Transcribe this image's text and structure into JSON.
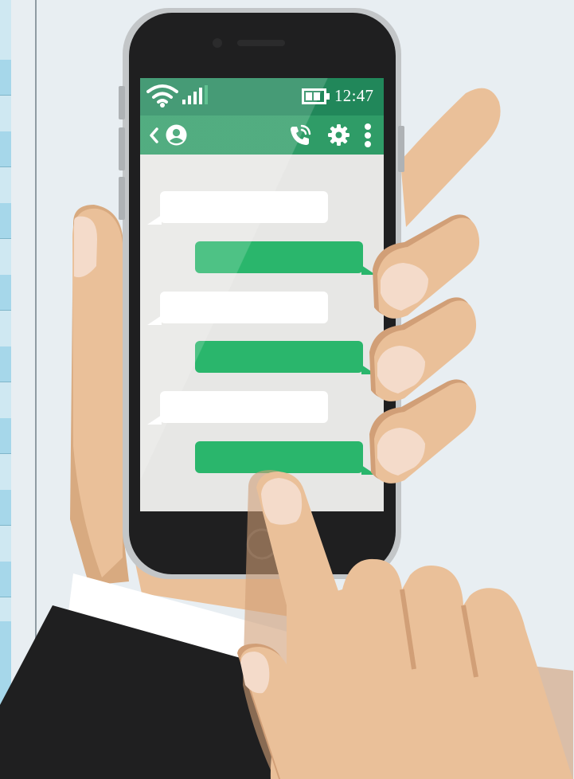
{
  "phone": {
    "status_bar": {
      "time": "12:47",
      "wifi_icon": "wifi-icon",
      "signal_icon": "signal-bars-icon",
      "battery_icon": "battery-icon"
    },
    "toolbar": {
      "back_icon": "chevron-left-icon",
      "contact_icon": "user-avatar-icon",
      "call_icon": "phone-call-icon",
      "settings_icon": "gear-icon",
      "menu_icon": "more-vertical-icon"
    },
    "chat": {
      "messages": [
        {
          "sender": "incoming",
          "text": ""
        },
        {
          "sender": "outgoing",
          "text": ""
        },
        {
          "sender": "incoming",
          "text": ""
        },
        {
          "sender": "outgoing",
          "text": ""
        },
        {
          "sender": "incoming",
          "text": ""
        },
        {
          "sender": "outgoing",
          "text": ""
        }
      ]
    }
  },
  "colors": {
    "background": "#e8eef2",
    "status_bar": "#21875a",
    "toolbar": "#2f9c67",
    "outgoing_bubble": "#2ab66c",
    "incoming_bubble": "#ffffff",
    "chat_background": "#e7e7e5",
    "phone_body": "#1f1f20",
    "phone_frame": "#c3c6c8",
    "skin": "#eac099",
    "nails": "#f4dbca",
    "sleeve": "#1f1f20",
    "cuff": "#ffffff"
  }
}
